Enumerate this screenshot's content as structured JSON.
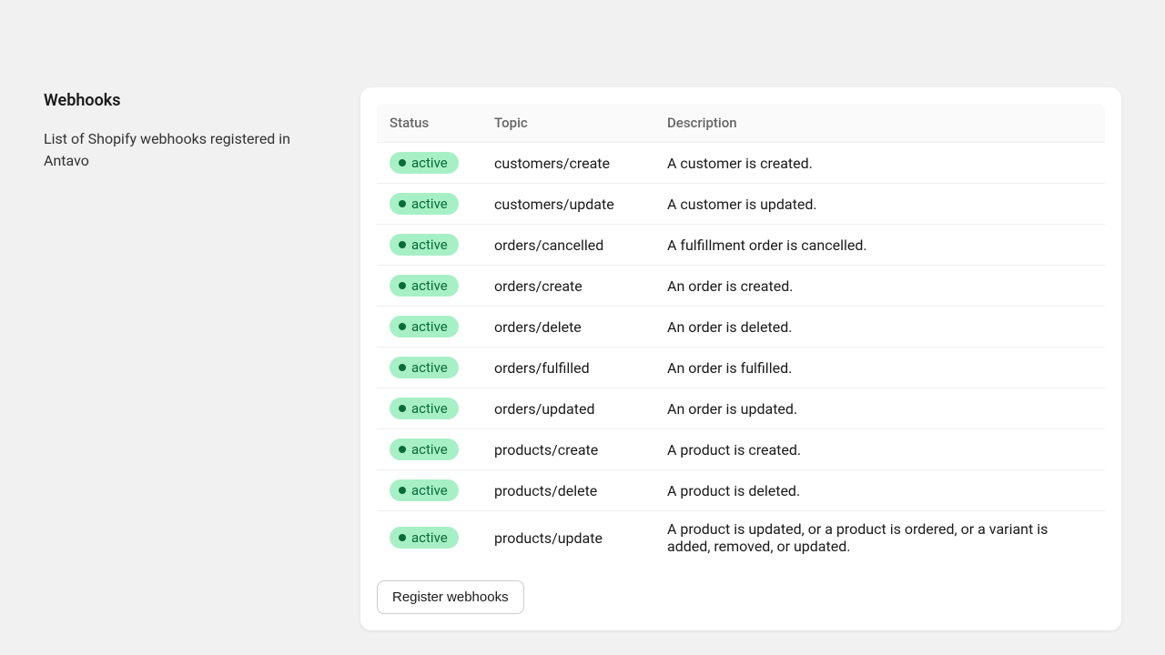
{
  "sidebar": {
    "title": "Webhooks",
    "description": "List of Shopify webhooks registered in Antavo"
  },
  "table": {
    "headers": {
      "status": "Status",
      "topic": "Topic",
      "description": "Description"
    },
    "rows": [
      {
        "status": "active",
        "topic": "customers/create",
        "description": "A customer is created."
      },
      {
        "status": "active",
        "topic": "customers/update",
        "description": "A customer is updated."
      },
      {
        "status": "active",
        "topic": "orders/cancelled",
        "description": "A fulfillment order is cancelled."
      },
      {
        "status": "active",
        "topic": "orders/create",
        "description": "An order is created."
      },
      {
        "status": "active",
        "topic": "orders/delete",
        "description": "An order is deleted."
      },
      {
        "status": "active",
        "topic": "orders/fulfilled",
        "description": "An order is fulfilled."
      },
      {
        "status": "active",
        "topic": "orders/updated",
        "description": "An order is updated."
      },
      {
        "status": "active",
        "topic": "products/create",
        "description": "A product is created."
      },
      {
        "status": "active",
        "topic": "products/delete",
        "description": "A product is deleted."
      },
      {
        "status": "active",
        "topic": "products/update",
        "description": "A product is updated, or a product is ordered, or a variant is added, removed, or updated."
      }
    ]
  },
  "actions": {
    "register_label": "Register webhooks"
  }
}
